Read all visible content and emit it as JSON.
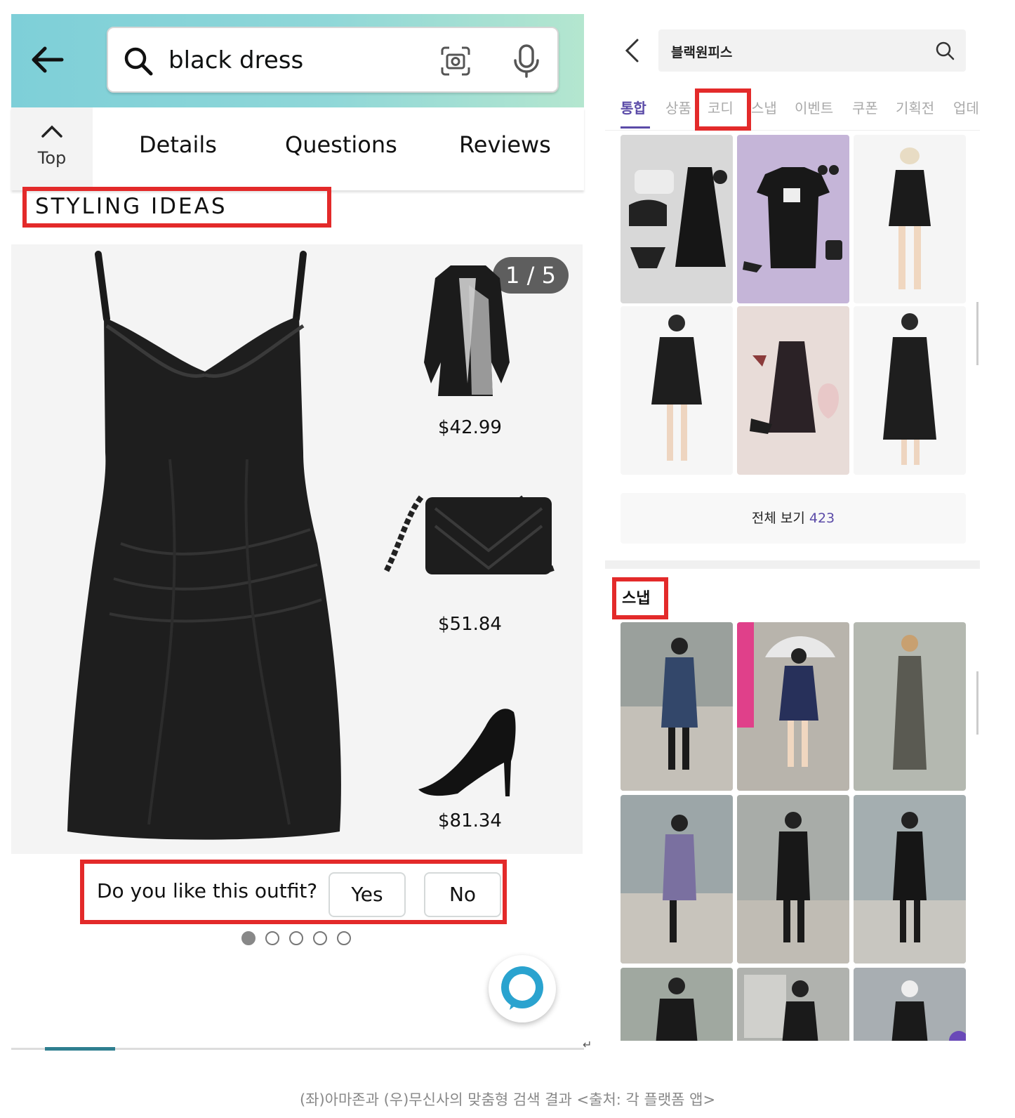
{
  "amazon": {
    "search": {
      "query": "black dress"
    },
    "nav": {
      "top_label": "Top",
      "tabs": [
        "Details",
        "Questions",
        "Reviews"
      ]
    },
    "section_title": "STYLING IDEAS",
    "carousel_counter": "1 / 5",
    "products": [
      {
        "name": "coat",
        "price": "$42.99"
      },
      {
        "name": "handbag",
        "price": "$51.84"
      },
      {
        "name": "heels",
        "price": "$81.34"
      }
    ],
    "feedback": {
      "question": "Do you like this outfit?",
      "yes": "Yes",
      "no": "No"
    },
    "pagination": {
      "total": 5,
      "active": 1
    },
    "colors": {
      "header_gradient_start": "#7ecfd8",
      "header_gradient_end": "#b4e6cf",
      "highlight": "#e32a2a"
    }
  },
  "musinsa": {
    "search": {
      "query": "블랙원피스"
    },
    "tabs": [
      "통합",
      "상품",
      "코디",
      "스냅",
      "이벤트",
      "쿠폰",
      "기획전",
      "업데"
    ],
    "active_tab": "통합",
    "view_all_label": "전체 보기",
    "view_all_count": "423",
    "snap_title": "스냅",
    "colors": {
      "accent": "#5b4ba8"
    }
  },
  "caption": "(좌)아마존과 (우)무신사의 맞춤형 검색 결과 <출처: 각 플랫폼 앱>"
}
